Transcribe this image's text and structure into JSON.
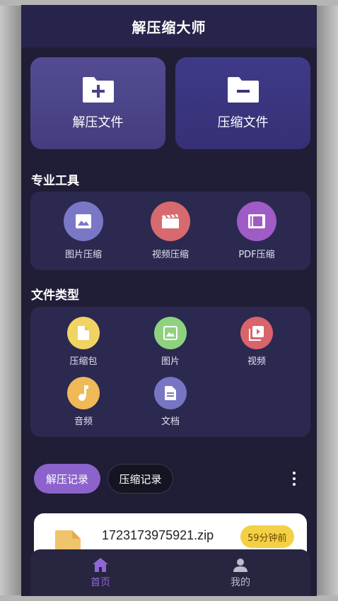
{
  "app": {
    "title": "解压缩大师"
  },
  "actions": [
    {
      "label": "解压文件",
      "icon": "folder-add-icon"
    },
    {
      "label": "压缩文件",
      "icon": "folder-remove-icon"
    }
  ],
  "pro_tools": {
    "title": "专业工具",
    "items": [
      {
        "label": "图片压缩",
        "icon": "image-icon",
        "color": "#7a78c6"
      },
      {
        "label": "视频压缩",
        "icon": "clapperboard-icon",
        "color": "#d66a6e"
      },
      {
        "label": "PDF压缩",
        "icon": "pdf-icon",
        "color": "#a05cc6"
      }
    ]
  },
  "file_types": {
    "title": "文件类型",
    "items": [
      {
        "label": "压缩包",
        "icon": "archive-file-icon",
        "color": "#f1d363"
      },
      {
        "label": "图片",
        "icon": "image-icon",
        "color": "#8ed27f"
      },
      {
        "label": "视频",
        "icon": "video-library-icon",
        "color": "#d9646c"
      },
      {
        "label": "音频",
        "icon": "music-note-icon",
        "color": "#efb958"
      },
      {
        "label": "文档",
        "icon": "document-icon",
        "color": "#7776c4"
      }
    ]
  },
  "records": {
    "tabs": [
      {
        "label": "解压记录",
        "active": true
      },
      {
        "label": "压缩记录",
        "active": false
      }
    ],
    "items": [
      {
        "name": "1723173975921.zip",
        "time": "59分钟前",
        "icon": "zip-file-icon"
      }
    ]
  },
  "nav": {
    "items": [
      {
        "label": "首页",
        "icon": "home-icon",
        "active": true
      },
      {
        "label": "我的",
        "icon": "user-icon",
        "active": false
      }
    ]
  },
  "colors": {
    "background": "#201e36",
    "accent": "#8c63cc",
    "card": "#2b2950"
  }
}
